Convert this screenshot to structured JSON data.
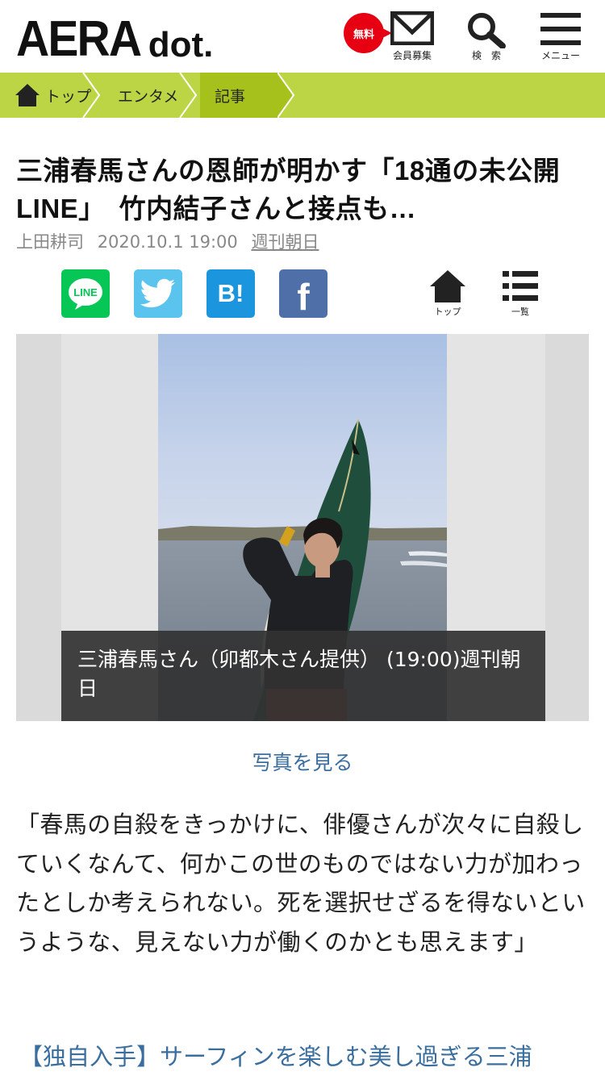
{
  "header": {
    "logo_main": "AERA",
    "logo_sub": "dot.",
    "free_badge": "無料",
    "member_label": "会員募集",
    "search_label": "検　索",
    "menu_label": "メニュー"
  },
  "breadcrumb": [
    {
      "label": "トップ"
    },
    {
      "label": "エンタメ"
    },
    {
      "label": "記事"
    }
  ],
  "article": {
    "title": "三浦春馬さんの恩師が明かす「18通の未公開LINE」　竹内結子さんと接点も…",
    "author": "上田耕司",
    "datetime": "2020.10.1 19:00",
    "source": "週刊朝日",
    "share": {
      "line_label": "LINE",
      "hatena_label": "B!",
      "facebook_label": "f"
    },
    "nav": {
      "top_label": "トップ",
      "list_label": "一覧"
    },
    "photo_caption": "三浦春馬さん（卯都木さん提供） (19:00)週刊朝日",
    "see_photos": "写真を見る",
    "body": "「春馬の自殺をきっかけに、俳優さんが次々に自殺していくなんて、何かこの世のものではない力が加わったとしか考えられない。死を選択せざるを得ないというような、見えない力が働くのかとも思えます」",
    "related_link": "【独自入手】サーフィンを楽しむ美し過ぎる三浦"
  },
  "colors": {
    "brand_green": "#bcd545",
    "brand_green_dark": "#a7c11c",
    "free_red": "#e60012",
    "link_blue": "#3a6e9f",
    "line_green": "#06c755",
    "twitter_blue": "#5bc4ee",
    "hatena_blue": "#1b96de",
    "facebook_blue": "#4e6fa8"
  },
  "icons": {
    "member": "envelope-icon",
    "search": "magnifier-icon",
    "menu": "hamburger-icon",
    "home": "house-icon",
    "list": "list-icon",
    "twitter": "bird-icon"
  }
}
